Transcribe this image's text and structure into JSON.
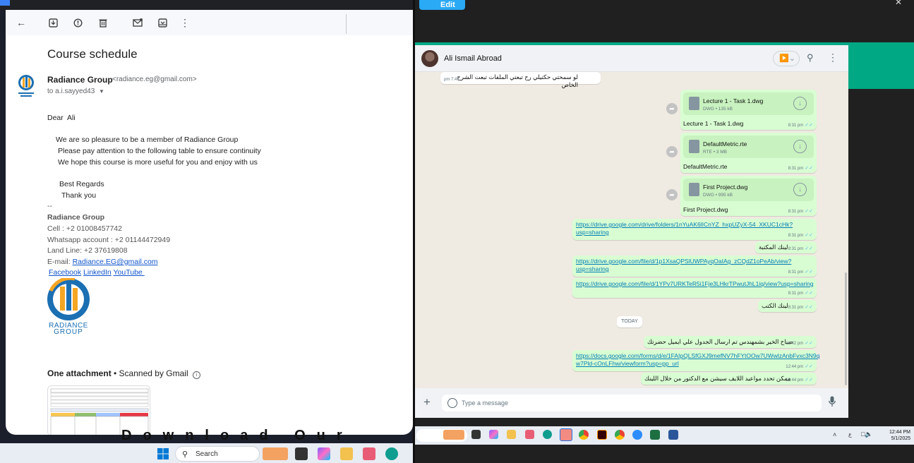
{
  "gmail": {
    "subject": "Course schedule",
    "sender_name": "Radiance Group",
    "sender_email": "<radiance.eg@gmail.com>",
    "recipient": "to a.i.sayyed43",
    "body": [
      "Dear  Ali",
      "We are so pleasure to be a member of Radiance Group",
      "Please pay attention to the following table to ensure continuity",
      "We hope this course is more useful for you and enjoy with us",
      "Best Regards",
      "Thank you"
    ],
    "signature": {
      "separator": "--",
      "company": "Radiance Group",
      "cell": "Cell : +2 01008457742",
      "whatsapp": "Whatsapp account : +2 01144472949",
      "landline": "Land Line: +2 37619808",
      "email_label": "E-mail: ",
      "email_link": "Radiance.EG@gmail.com",
      "facebook": "Facebook",
      "linkedin": "LinkedIn",
      "youtube": "YouTube ",
      "logo_text_1": "RADIANCE",
      "logo_text_2": "GROUP"
    },
    "attachment_title": "One attachment",
    "attachment_note": " • Scanned by Gmail",
    "download_banner": "Download Our App"
  },
  "left_taskbar": {
    "search_label": "Search"
  },
  "right_topbar": {
    "edit_label": "Edit"
  },
  "whatsapp": {
    "contact_name": "Ali Ismail Abroad",
    "input_placeholder": "Type a message",
    "today_label": "TODAY",
    "messages": [
      {
        "text": "لو سمحتي حكتيلي رح تبعتي الملفات تبعت الشرح الخاص",
        "time": "7:47 pm"
      },
      {
        "file": "Lecture 1 - Task 1.dwg",
        "info": "DWG • 135 kB",
        "caption": "Lecture 1 - Task 1.dwg",
        "time": "8:31 pm"
      },
      {
        "file": "DefaultMetric.rte",
        "info": "RTE • 3 MB",
        "caption": "DefaultMetric.rte",
        "time": "8:31 pm"
      },
      {
        "file": "First Project.dwg",
        "info": "DWG • 995 kB",
        "caption": "First Project.dwg",
        "time": "8:31 pm"
      },
      {
        "link1": "https://drive.google.com/drive/folders/1nYuAK6lICnYZ_hxpUZyX-54_XKUC1cHk?",
        "link2": "usp=sharing",
        "time": "8:31 pm"
      },
      {
        "text": "لينك المكتبة",
        "time": "8:31 pm"
      },
      {
        "link1": "https://drive.google.com/file/d/1p1XsaQPSlUWPAyqOaIAg_zCQdZ1oPeAb/view?",
        "link2": "usp=sharing",
        "time": "8:31 pm"
      },
      {
        "link1": "https://drive.google.com/file/d/1YPv7URKTeR5i1Fje3LHkrTPwutJhL1iq/view?usp=sharing",
        "time": "8:31 pm"
      },
      {
        "text": "لينك الكتب",
        "time": "8:31 pm"
      },
      {
        "text": "صباح الخير بشمهندس تم ارسال الجدول علي ايميل حضرتك",
        "time": "12:42 pm"
      },
      {
        "link1": "https://docs.google.com/forms/d/e/1FAIpQLSfGXJ9mefNV7hFYtOOw7UWwlzAnbFvxc3N9q",
        "link2": "w7Pld-cOnLFhw/viewform?usp=pp_url",
        "time": "12:44 pm"
      },
      {
        "text": "ممكن تحدد مواعيد اللايف سيشن مع الدكتور من خلال اللينك",
        "time": "12:44 pm"
      }
    ]
  },
  "right_taskbar": {
    "time": "12:44 PM",
    "date": "5/1/2025"
  },
  "colors": {
    "wa_green": "#00a884",
    "out_bubble": "#d9fdd3",
    "link_blue": "#1155cc",
    "tick_blue": "#53bdeb"
  }
}
